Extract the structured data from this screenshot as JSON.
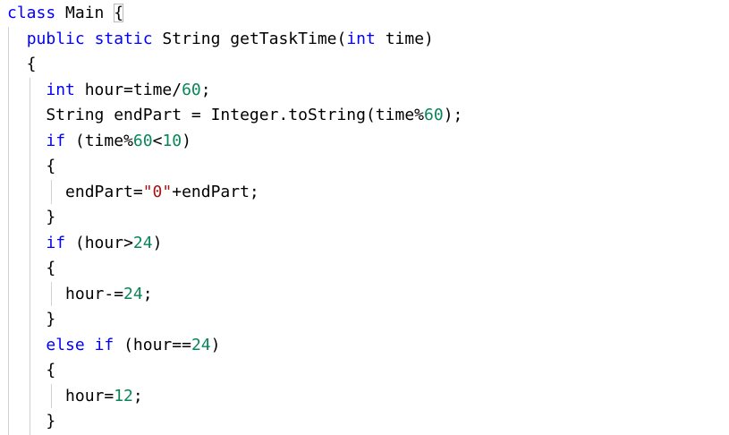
{
  "editor": {
    "language": "java",
    "colors": {
      "keyword": "#0000ff",
      "number": "#098658",
      "string": "#a31515",
      "text": "#000000",
      "indent_guide": "#d3d3d3"
    },
    "lines": [
      [
        {
          "t": "kw",
          "v": "class"
        },
        {
          "t": "plain",
          "v": " Main "
        },
        {
          "t": "plain",
          "v": "{",
          "box": true
        }
      ],
      [
        {
          "t": "plain",
          "v": "  "
        },
        {
          "t": "kw",
          "v": "public"
        },
        {
          "t": "plain",
          "v": " "
        },
        {
          "t": "kw",
          "v": "static"
        },
        {
          "t": "plain",
          "v": " String getTaskTime("
        },
        {
          "t": "kw",
          "v": "int"
        },
        {
          "t": "plain",
          "v": " time)"
        }
      ],
      [
        {
          "t": "plain",
          "v": "  {"
        }
      ],
      [
        {
          "t": "plain",
          "v": "    "
        },
        {
          "t": "kw",
          "v": "int"
        },
        {
          "t": "plain",
          "v": " hour=time/"
        },
        {
          "t": "num",
          "v": "60"
        },
        {
          "t": "plain",
          "v": ";"
        }
      ],
      [
        {
          "t": "plain",
          "v": "    String endPart = Integer.toString(time%"
        },
        {
          "t": "num",
          "v": "60"
        },
        {
          "t": "plain",
          "v": ");"
        }
      ],
      [
        {
          "t": "plain",
          "v": "    "
        },
        {
          "t": "kw",
          "v": "if"
        },
        {
          "t": "plain",
          "v": " (time%"
        },
        {
          "t": "num",
          "v": "60"
        },
        {
          "t": "plain",
          "v": "<"
        },
        {
          "t": "num",
          "v": "10"
        },
        {
          "t": "plain",
          "v": ")"
        }
      ],
      [
        {
          "t": "plain",
          "v": "    {"
        }
      ],
      [
        {
          "t": "plain",
          "v": "      endPart="
        },
        {
          "t": "str",
          "v": "\"0\""
        },
        {
          "t": "plain",
          "v": "+endPart;"
        }
      ],
      [
        {
          "t": "plain",
          "v": "    }"
        }
      ],
      [
        {
          "t": "plain",
          "v": "    "
        },
        {
          "t": "kw",
          "v": "if"
        },
        {
          "t": "plain",
          "v": " (hour>"
        },
        {
          "t": "num",
          "v": "24"
        },
        {
          "t": "plain",
          "v": ")"
        }
      ],
      [
        {
          "t": "plain",
          "v": "    {"
        }
      ],
      [
        {
          "t": "plain",
          "v": "      hour-="
        },
        {
          "t": "num",
          "v": "24"
        },
        {
          "t": "plain",
          "v": ";"
        }
      ],
      [
        {
          "t": "plain",
          "v": "    }"
        }
      ],
      [
        {
          "t": "plain",
          "v": "    "
        },
        {
          "t": "kw",
          "v": "else"
        },
        {
          "t": "plain",
          "v": " "
        },
        {
          "t": "kw",
          "v": "if"
        },
        {
          "t": "plain",
          "v": " (hour=="
        },
        {
          "t": "num",
          "v": "24"
        },
        {
          "t": "plain",
          "v": ")"
        }
      ],
      [
        {
          "t": "plain",
          "v": "    {"
        }
      ],
      [
        {
          "t": "plain",
          "v": "      hour="
        },
        {
          "t": "num",
          "v": "12"
        },
        {
          "t": "plain",
          "v": ";"
        }
      ],
      [
        {
          "t": "plain",
          "v": "    }"
        }
      ]
    ]
  }
}
